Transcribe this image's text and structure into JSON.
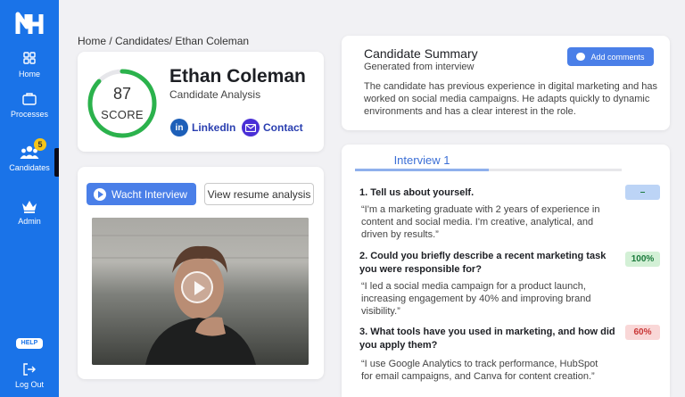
{
  "sidebar": {
    "logo_text": "NH",
    "items": [
      {
        "label": "Home",
        "icon": "grid-icon"
      },
      {
        "label": "Processes",
        "icon": "briefcase-icon"
      },
      {
        "label": "Candidates",
        "icon": "users-icon",
        "badge": "5",
        "active": true
      },
      {
        "label": "Admin",
        "icon": "crown-icon"
      }
    ],
    "help_label": "HELP",
    "logout_label": "Log Out"
  },
  "breadcrumb": "Home / Candidates/  Ethan Coleman",
  "profile": {
    "score": "87",
    "score_label": "SCORE",
    "score_fraction": 0.87,
    "name": "Ethan Coleman",
    "subtitle": "Candidate Analysis",
    "linkedin_label": "LinkedIn",
    "contact_label": "Contact"
  },
  "video": {
    "watch_label": "Wacht Interview",
    "resume_label": "View resume analysis"
  },
  "summary": {
    "title": "Candidate Summary",
    "subtitle": "Generated from interview",
    "text": "The candidate has previous experience in digital marketing and has worked on social media campaigns. He adapts quickly to dynamic environments and has a clear interest in the role.",
    "comment_label": "Add comments"
  },
  "interview": {
    "tab_label": "Interview 1",
    "questions": [
      {
        "q": "1.  Tell us about yourself.",
        "a": "“I'm a marketing graduate with 2 years of experience in content and social media. I'm creative, analytical, and driven by results.”",
        "score": "–"
      },
      {
        "q": "2. Could you briefly describe a recent marketing task you were responsible for?",
        "a": "“I led a social media campaign for a product launch, increasing engagement by 40% and improving brand visibility.”",
        "score": "100%"
      },
      {
        "q": "3. What tools have you used in marketing, and how did you apply them?",
        "a": "“I use Google Analytics to track performance, HubSpot for email campaigns, and Canva for content creation.”",
        "score": "60%"
      }
    ]
  },
  "colors": {
    "sidebar_bg": "#1a73e8",
    "accent": "#4a7fe8",
    "score_green": "#2bb24c",
    "badge_yellow": "#f5c518"
  }
}
